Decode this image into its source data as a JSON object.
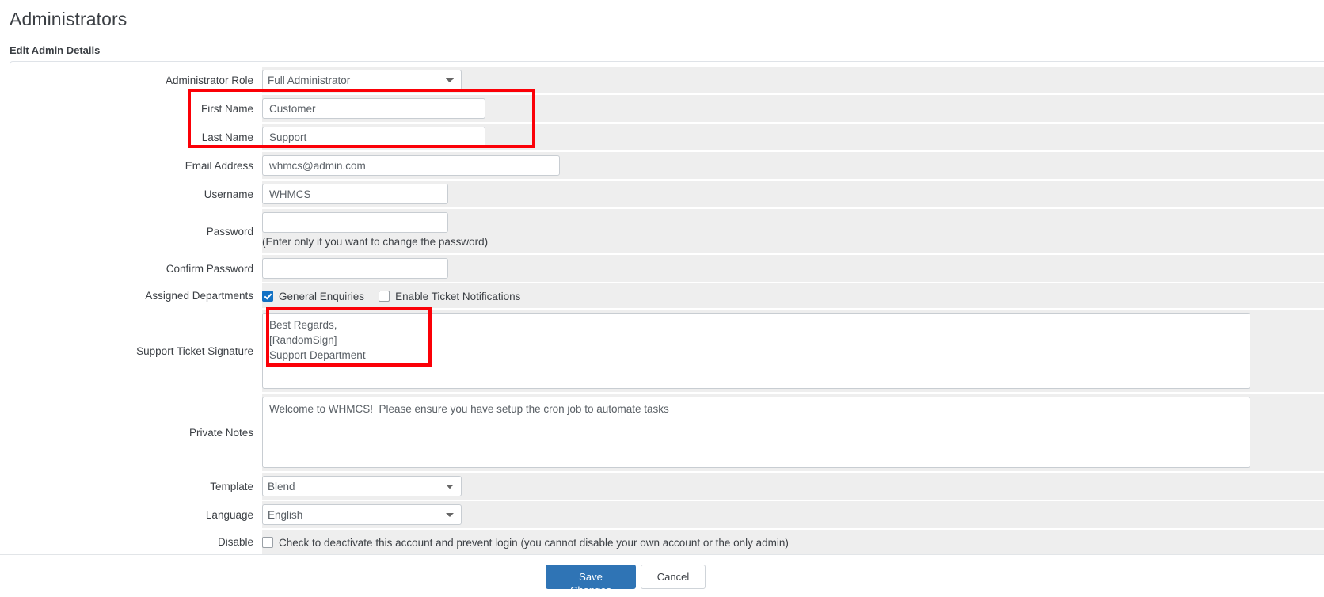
{
  "header": {
    "page_title": "Administrators",
    "section_title": "Edit Admin Details"
  },
  "form": {
    "administrator_role": {
      "label": "Administrator Role",
      "value": "Full Administrator",
      "options": [
        "Full Administrator"
      ]
    },
    "first_name": {
      "label": "First Name",
      "value": "Customer"
    },
    "last_name": {
      "label": "Last Name",
      "value": "Support"
    },
    "email_address": {
      "label": "Email Address",
      "value": "whmcs@admin.com"
    },
    "username": {
      "label": "Username",
      "value": "WHMCS"
    },
    "password": {
      "label": "Password",
      "value": "",
      "help": "(Enter only if you want to change the password)"
    },
    "confirm_password": {
      "label": "Confirm Password",
      "value": ""
    },
    "assigned_departments": {
      "label": "Assigned Departments",
      "checkboxes": [
        {
          "label": "General Enquiries",
          "checked": true
        },
        {
          "label": "Enable Ticket Notifications",
          "checked": false
        }
      ]
    },
    "support_ticket_signature": {
      "label": "Support Ticket Signature",
      "value": "Best Regards,\n[RandomSign]\nSupport Department"
    },
    "private_notes": {
      "label": "Private Notes",
      "value": "Welcome to WHMCS!  Please ensure you have setup the cron job to automate tasks"
    },
    "template": {
      "label": "Template",
      "value": "Blend",
      "options": [
        "Blend"
      ]
    },
    "language": {
      "label": "Language",
      "value": "English",
      "options": [
        "English"
      ]
    },
    "disable": {
      "label": "Disable",
      "checkbox_label": "Check to deactivate this account and prevent login (you cannot disable your own account or the only admin)",
      "checked": false
    }
  },
  "footer": {
    "save_label": "Save Changes",
    "cancel_label": "Cancel"
  },
  "annotations": {
    "highlight_color": "#fb0007",
    "boxes": [
      {
        "name": "name-fields-highlight"
      },
      {
        "name": "signature-highlight"
      }
    ]
  }
}
